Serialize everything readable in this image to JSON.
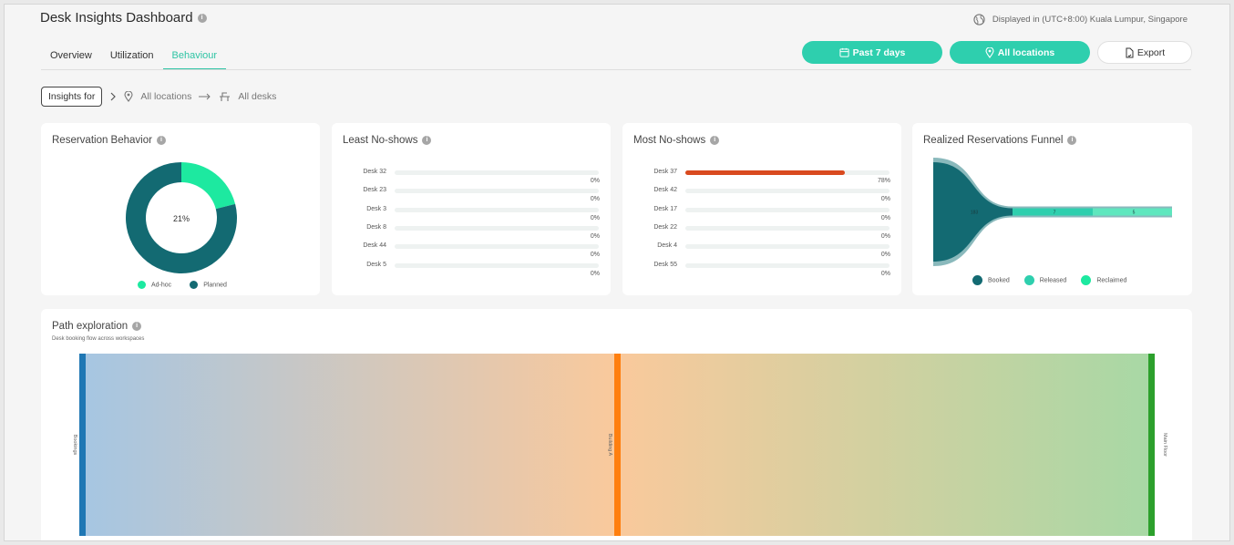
{
  "header": {
    "title": "Desk Insights Dashboard",
    "timezone": "Displayed in (UTC+8:00) Kuala Lumpur, Singapore"
  },
  "tabs": [
    {
      "label": "Overview"
    },
    {
      "label": "Utilization"
    },
    {
      "label": "Behaviour",
      "active": true
    }
  ],
  "toolbar": {
    "date_label": "Past 7 days",
    "location_label": "All locations",
    "export_label": "Export"
  },
  "breadcrumb": {
    "insights_label": "Insights for",
    "location": "All locations",
    "desks": "All desks"
  },
  "cards": {
    "reservation_behavior": {
      "title": "Reservation Behavior"
    },
    "least_noshows": {
      "title": "Least No-shows"
    },
    "most_noshows": {
      "title": "Most No-shows"
    },
    "funnel": {
      "title": "Realized Reservations Funnel"
    },
    "path": {
      "title": "Path exploration",
      "subtitle": "Desk booking flow across workspaces"
    }
  },
  "colors": {
    "accent": "#2ecfae",
    "teal_dark": "#136a72",
    "adhoc": "#1de9a0",
    "bar_red": "#d94a1f",
    "node_blue": "#1f77b4",
    "node_orange": "#ff7f0e",
    "node_green": "#2ca02c"
  },
  "chart_data": [
    {
      "type": "pie",
      "title": "Reservation Behavior",
      "categories": [
        "Ad-hoc",
        "Planned"
      ],
      "values": [
        21,
        79
      ],
      "center_label": "21%",
      "legend": "bottom"
    },
    {
      "type": "bar",
      "title": "Least No-shows",
      "categories": [
        "Desk 32",
        "Desk 23",
        "Desk 3",
        "Desk 8",
        "Desk 44",
        "Desk 5"
      ],
      "values": [
        0,
        0,
        0,
        0,
        0,
        0
      ],
      "value_labels": [
        "0%",
        "0%",
        "0%",
        "0%",
        "0%",
        "0%"
      ],
      "xlim": [
        0,
        100
      ]
    },
    {
      "type": "bar",
      "title": "Most No-shows",
      "categories": [
        "Desk 37",
        "Desk 42",
        "Desk 17",
        "Desk 22",
        "Desk 4",
        "Desk 55"
      ],
      "values": [
        78,
        0,
        0,
        0,
        0,
        0
      ],
      "value_labels": [
        "78%",
        "0%",
        "0%",
        "0%",
        "0%",
        "0%"
      ],
      "xlim": [
        0,
        100
      ]
    },
    {
      "type": "area",
      "title": "Realized Reservations Funnel",
      "categories": [
        "Booked",
        "Released",
        "Reclaimed"
      ],
      "values": [
        183,
        7,
        5
      ],
      "value_labels": [
        "183",
        "7",
        "5"
      ],
      "legend": "bottom"
    },
    {
      "type": "sankey",
      "title": "Path exploration",
      "nodes": [
        "Bookings",
        "Building A",
        "Main Floor"
      ],
      "links": [
        {
          "source": "Bookings",
          "target": "Building A",
          "value": 1
        },
        {
          "source": "Building A",
          "target": "Main Floor",
          "value": 1
        }
      ]
    }
  ]
}
